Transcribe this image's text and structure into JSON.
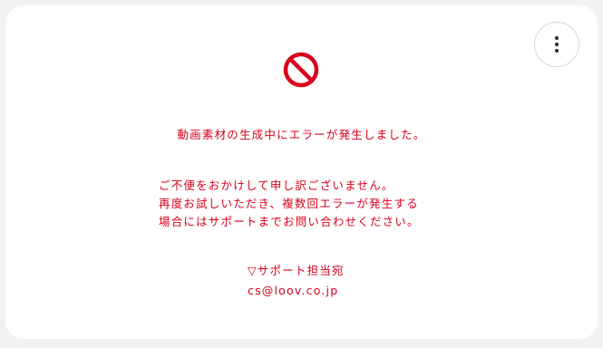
{
  "colors": {
    "accent": "#d9001b",
    "card_background": "#ffffff",
    "page_background": "#f2f2f2",
    "menu_border": "#d6d6d6",
    "menu_dots": "#333333"
  },
  "icons": {
    "menu": "more-vertical-icon",
    "error": "prohibited-icon"
  },
  "error": {
    "title": "動画素材の生成中にエラーが発生しました。",
    "apology_lines": [
      "ご不便をおかけして申し訳ございません。",
      "再度お試しいただき、複数回エラーが発生する",
      "場合にはサポートまでお問い合わせください。"
    ]
  },
  "support": {
    "label": "▽サポート担当宛",
    "email": "cs@loov.co.jp"
  }
}
